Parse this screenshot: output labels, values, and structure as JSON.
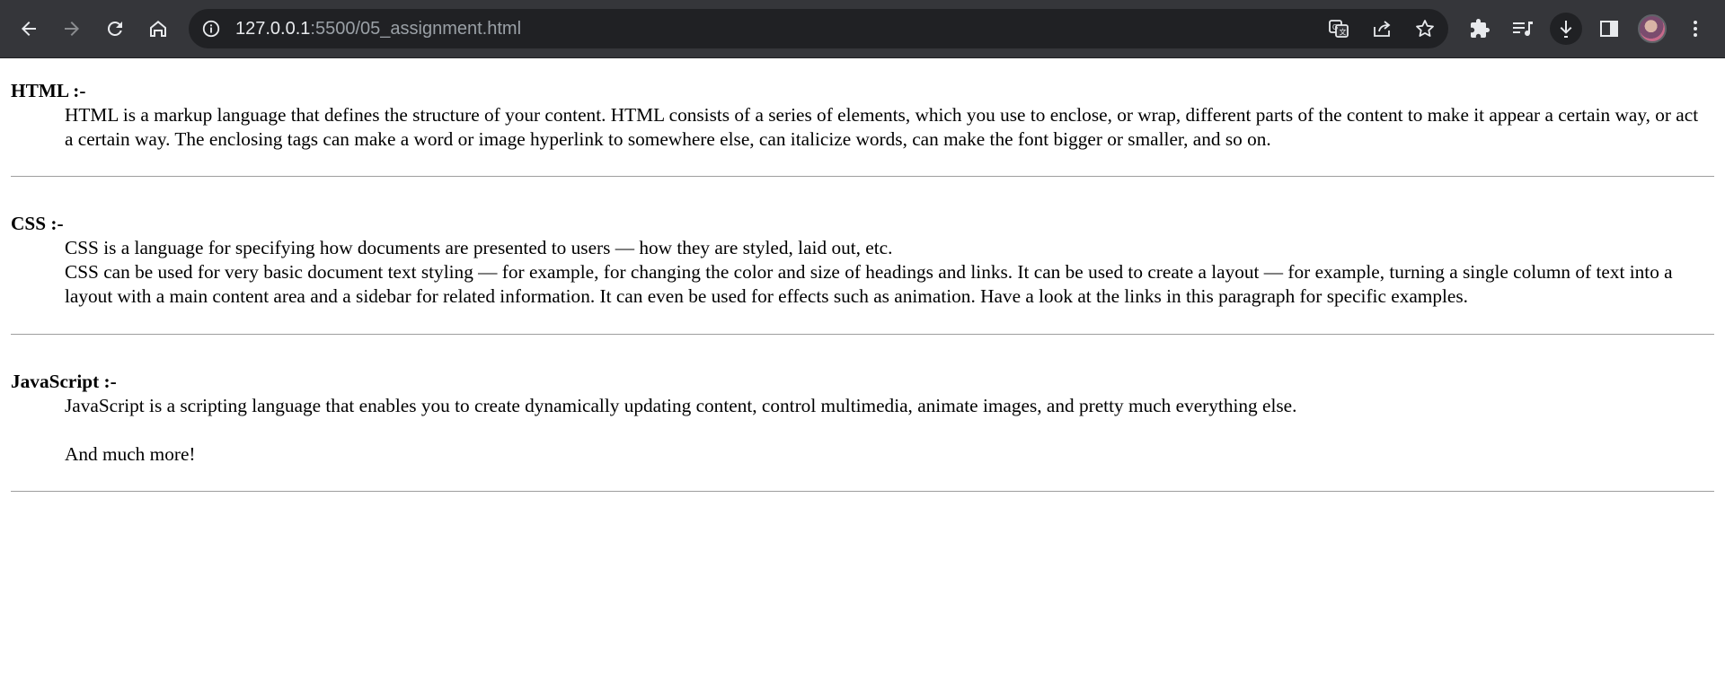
{
  "browser": {
    "url_host": "127.0.0.1",
    "url_rest": ":5500/05_assignment.html",
    "icons": {
      "back": "arrow-left-icon",
      "forward": "arrow-right-icon",
      "reload": "reload-icon",
      "home": "home-icon",
      "site_info": "info-icon",
      "translate": "translate-icon",
      "share": "share-icon",
      "bookmark": "star-icon",
      "extensions": "puzzle-icon",
      "media": "media-queue-icon",
      "downloads": "download-icon",
      "side_panel": "side-panel-icon",
      "menu": "kebab-menu-icon"
    },
    "colors": {
      "toolbar_bg": "#35363a",
      "omnibox_bg": "#202124",
      "icon": "#e8eaed"
    }
  },
  "page": {
    "sections": [
      {
        "term": "HTML :-",
        "lines": [
          "HTML is a markup language that defines the structure of your content. HTML consists of a series of elements, which you use to enclose, or wrap, different parts of the content to make it appear a certain way, or act a certain way. The enclosing tags can make a word or image hyperlink to somewhere else, can italicize words, can make the font bigger or smaller, and so on."
        ]
      },
      {
        "term": "CSS :-",
        "lines": [
          "CSS is a language for specifying how documents are presented to users — how they are styled, laid out, etc.",
          "CSS can be used for very basic document text styling — for example, for changing the color and size of headings and links. It can be used to create a layout — for example, turning a single column of text into a layout with a main content area and a sidebar for related information. It can even be used for effects such as animation. Have a look at the links in this paragraph for specific examples."
        ]
      },
      {
        "term": "JavaScript :-",
        "lines": [
          "JavaScript is a scripting language that enables you to create dynamically updating content, control multimedia, animate images, and pretty much everything else.",
          "And much more!"
        ]
      }
    ]
  }
}
